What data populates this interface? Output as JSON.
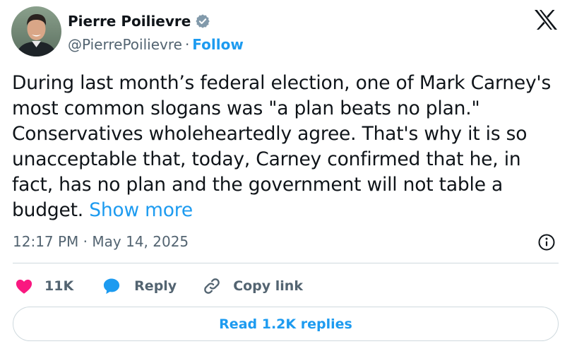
{
  "author": {
    "name": "Pierre Poilievre",
    "handle": "@PierrePoilievre",
    "separator": "·",
    "follow_label": "Follow",
    "verified_icon": "verified-badge-icon",
    "avatar": "profile-photo"
  },
  "platform_logo": "x-logo-icon",
  "tweet": {
    "text": "During last month’s federal election, one of Mark Carney's most common slogans was \"a plan beats no plan.\" Conservatives wholeheartedly agree. That's why it is so unacceptable that, today, Carney confirmed that he, in fact, has no plan and the government will not table a budget.",
    "show_more_label": "Show more",
    "timestamp": "12:17 PM · May 14, 2025",
    "info_icon": "info-icon"
  },
  "actions": {
    "like_count": "11K",
    "reply_label": "Reply",
    "copy_link_label": "Copy link",
    "icons": [
      "heart-icon",
      "reply-bubble-icon",
      "link-icon"
    ]
  },
  "read_replies_label": "Read 1.2K replies",
  "colors": {
    "accent": "#1d9bf0",
    "like": "#f91880",
    "text_primary": "#0f1419",
    "text_secondary": "#536471",
    "border": "#cfd9de",
    "verified": "#829aab"
  }
}
